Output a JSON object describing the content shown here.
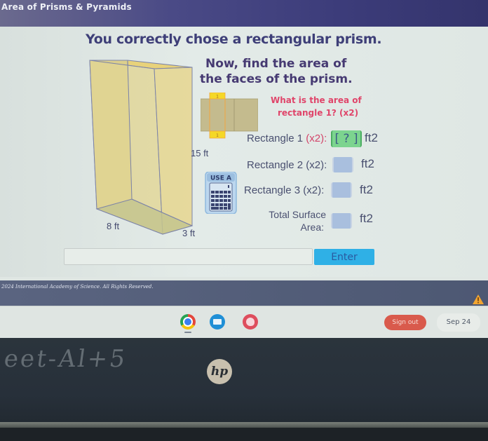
{
  "app": {
    "title": "Area of Prisms & Pyramids"
  },
  "lesson": {
    "headline": "You correctly chose a rectangular prism.",
    "instruction_line1": "Now, find the area of",
    "instruction_line2": "the faces of the prism.",
    "question_line1": "What is the area of",
    "question_line2": "rectangle 1? (x2)",
    "prism": {
      "height_label": "15 ft",
      "length_label": "8 ft",
      "width_label": "3 ft"
    },
    "net": {
      "top_face_label": "1",
      "bottom_face_label": "1"
    },
    "calculator_hint": "USE A",
    "rows": [
      {
        "label": "Rectangle 1",
        "multiplier": "(x2):",
        "value": "[ ? ]",
        "unit": "ft2",
        "active": true
      },
      {
        "label": "Rectangle 2",
        "multiplier": "(x2):",
        "value": "",
        "unit": "ft2",
        "active": false
      },
      {
        "label": "Rectangle 3",
        "multiplier": "(x2):",
        "value": "",
        "unit": "ft2",
        "active": false
      },
      {
        "label_line1": "Total Surface",
        "label_line2": "Area:",
        "value": "",
        "unit": "ft2",
        "active": false
      }
    ]
  },
  "entry": {
    "input_value": "",
    "input_placeholder": "",
    "enter_label": "Enter"
  },
  "footer": {
    "copyright": "2024 International Academy of Science. All Rights Reserved."
  },
  "shelf": {
    "apps": [
      "chrome-icon",
      "classroom-icon",
      "palette-icon"
    ],
    "signout_label": "Sign out",
    "date": "Sep 24"
  },
  "device": {
    "brand": "hp",
    "scribble": "eet-Al+5"
  },
  "colors": {
    "header": "#3c3c7a",
    "headline": "#3e3f78",
    "question": "#e0456a",
    "active_box": "#7cd48f",
    "empty_box": "#a9bfde",
    "enter_button": "#2fb0e6",
    "signout": "#d95a4c",
    "footer": "#55607a"
  }
}
